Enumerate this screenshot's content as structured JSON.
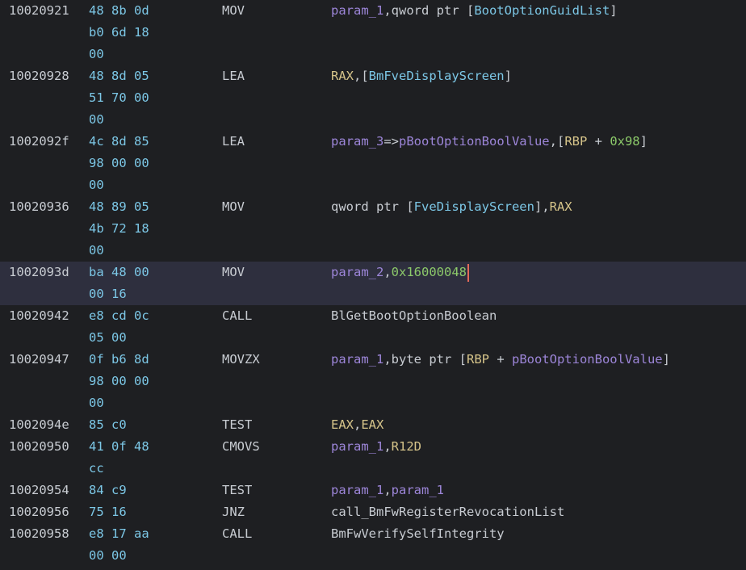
{
  "colors": {
    "background": "#1e1f22",
    "selection": "#2e2f3e",
    "address": "#c8ccd2",
    "bytes": "#7cc7e6",
    "param": "#9d86d9",
    "register": "#d6c48a",
    "number": "#8cc96a",
    "cursor": "#e36a5a"
  },
  "instructions": [
    {
      "address": "10020921",
      "bytes": [
        "48 8b 0d",
        "b0 6d 18",
        "00"
      ],
      "mnemonic": "MOV",
      "operands": [
        {
          "text": "param_1",
          "kind": "param"
        },
        {
          "text": ",qword ptr [",
          "kind": "plain"
        },
        {
          "text": "BootOptionGuidList",
          "kind": "ref"
        },
        {
          "text": "]",
          "kind": "plain"
        }
      ],
      "selected": false,
      "cursor": false
    },
    {
      "address": "10020928",
      "bytes": [
        "48 8d 05",
        "51 70 00",
        "00"
      ],
      "mnemonic": "LEA",
      "operands": [
        {
          "text": "RAX",
          "kind": "reg"
        },
        {
          "text": ",[",
          "kind": "plain"
        },
        {
          "text": "BmFveDisplayScreen",
          "kind": "ref"
        },
        {
          "text": "]",
          "kind": "plain"
        }
      ],
      "selected": false,
      "cursor": false
    },
    {
      "address": "1002092f",
      "bytes": [
        "4c 8d 85",
        "98 00 00",
        "00"
      ],
      "mnemonic": "LEA",
      "operands": [
        {
          "text": "param_3",
          "kind": "param"
        },
        {
          "text": "=>",
          "kind": "plain"
        },
        {
          "text": "pBootOptionBoolValue",
          "kind": "param"
        },
        {
          "text": ",[",
          "kind": "plain"
        },
        {
          "text": "RBP",
          "kind": "reg"
        },
        {
          "text": " + ",
          "kind": "plain"
        },
        {
          "text": "0x98",
          "kind": "num"
        },
        {
          "text": "]",
          "kind": "plain"
        }
      ],
      "selected": false,
      "cursor": false
    },
    {
      "address": "10020936",
      "bytes": [
        "48 89 05",
        "4b 72 18",
        "00"
      ],
      "mnemonic": "MOV",
      "operands": [
        {
          "text": "qword ptr [",
          "kind": "plain"
        },
        {
          "text": "FveDisplayScreen",
          "kind": "ref"
        },
        {
          "text": "],",
          "kind": "plain"
        },
        {
          "text": "RAX",
          "kind": "reg"
        }
      ],
      "selected": false,
      "cursor": false
    },
    {
      "address": "1002093d",
      "bytes": [
        "ba 48 00",
        "00 16"
      ],
      "mnemonic": "MOV",
      "operands": [
        {
          "text": "param_2",
          "kind": "param"
        },
        {
          "text": ",",
          "kind": "plain"
        },
        {
          "text": "0x16000048",
          "kind": "num"
        }
      ],
      "selected": true,
      "cursor": true
    },
    {
      "address": "10020942",
      "bytes": [
        "e8 cd 0c",
        "05 00"
      ],
      "mnemonic": "CALL",
      "operands": [
        {
          "text": "BlGetBootOptionBoolean",
          "kind": "func"
        }
      ],
      "selected": false,
      "cursor": false
    },
    {
      "address": "10020947",
      "bytes": [
        "0f b6 8d",
        "98 00 00",
        "00"
      ],
      "mnemonic": "MOVZX",
      "operands": [
        {
          "text": "param_1",
          "kind": "param"
        },
        {
          "text": ",byte ptr [",
          "kind": "plain"
        },
        {
          "text": "RBP",
          "kind": "reg"
        },
        {
          "text": " + ",
          "kind": "plain"
        },
        {
          "text": "pBootOptionBoolValue",
          "kind": "param"
        },
        {
          "text": "]",
          "kind": "plain"
        }
      ],
      "selected": false,
      "cursor": false
    },
    {
      "address": "1002094e",
      "bytes": [
        "85 c0"
      ],
      "mnemonic": "TEST",
      "operands": [
        {
          "text": "EAX",
          "kind": "reg"
        },
        {
          "text": ",",
          "kind": "plain"
        },
        {
          "text": "EAX",
          "kind": "reg"
        }
      ],
      "selected": false,
      "cursor": false
    },
    {
      "address": "10020950",
      "bytes": [
        "41 0f 48",
        "cc"
      ],
      "mnemonic": "CMOVS",
      "operands": [
        {
          "text": "param_1",
          "kind": "param"
        },
        {
          "text": ",",
          "kind": "plain"
        },
        {
          "text": "R12D",
          "kind": "reg"
        }
      ],
      "selected": false,
      "cursor": false
    },
    {
      "address": "10020954",
      "bytes": [
        "84 c9"
      ],
      "mnemonic": "TEST",
      "operands": [
        {
          "text": "param_1",
          "kind": "param"
        },
        {
          "text": ",",
          "kind": "plain"
        },
        {
          "text": "param_1",
          "kind": "param"
        }
      ],
      "selected": false,
      "cursor": false
    },
    {
      "address": "10020956",
      "bytes": [
        "75 16"
      ],
      "mnemonic": "JNZ",
      "operands": [
        {
          "text": "call_BmFwRegisterRevocationList",
          "kind": "func"
        }
      ],
      "selected": false,
      "cursor": false
    },
    {
      "address": "10020958",
      "bytes": [
        "e8 17 aa",
        "00 00"
      ],
      "mnemonic": "CALL",
      "operands": [
        {
          "text": "BmFwVerifySelfIntegrity",
          "kind": "func"
        }
      ],
      "selected": false,
      "cursor": false
    }
  ]
}
